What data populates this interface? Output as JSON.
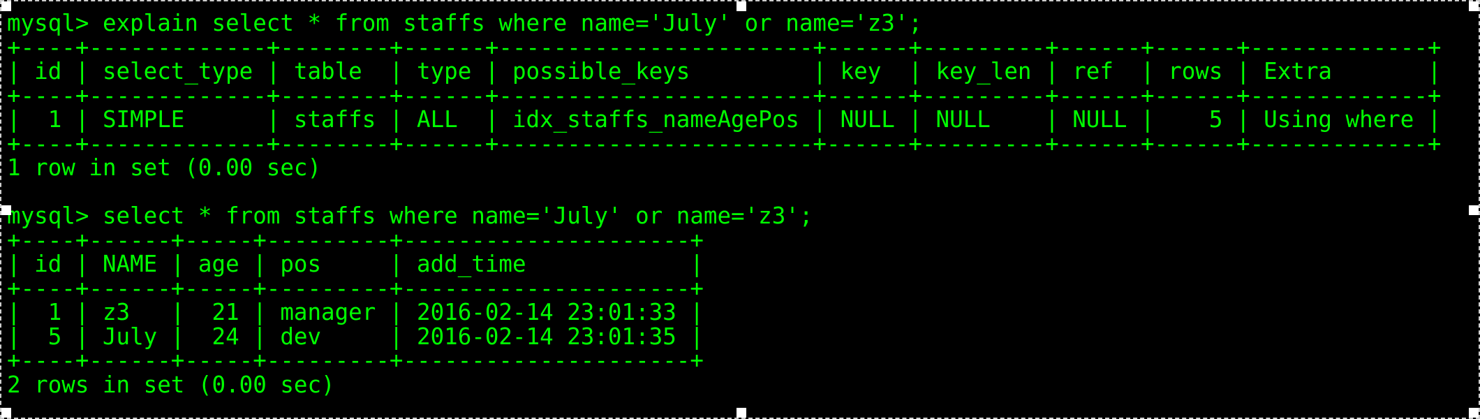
{
  "terminal": {
    "text_color": "#00ff00",
    "background_color": "#000000",
    "selection_border_color": "#cfcfcf",
    "lines": [
      "mysql> explain select * from staffs where name='July' or name='z3';",
      "+----+-------------+--------+------+-----------------------+------+---------+------+------+-------------+",
      "| id | select_type | table  | type | possible_keys         | key  | key_len | ref  | rows | Extra       |",
      "+----+-------------+--------+------+-----------------------+------+---------+------+------+-------------+",
      "|  1 | SIMPLE      | staffs | ALL  | idx_staffs_nameAgePos | NULL | NULL    | NULL |    5 | Using where |",
      "+----+-------------+--------+------+-----------------------+------+---------+------+------+-------------+",
      "1 row in set (0.00 sec)",
      "",
      "mysql> select * from staffs where name='July' or name='z3';",
      "+----+------+-----+---------+---------------------+",
      "| id | NAME | age | pos     | add_time            |",
      "+----+------+-----+---------+---------------------+",
      "|  1 | z3   |  21 | manager | 2016-02-14 23:01:33 |",
      "|  5 | July |  24 | dev     | 2016-02-14 23:01:35 |",
      "+----+------+-----+---------+---------------------+",
      "2 rows in set (0.00 sec)"
    ]
  }
}
